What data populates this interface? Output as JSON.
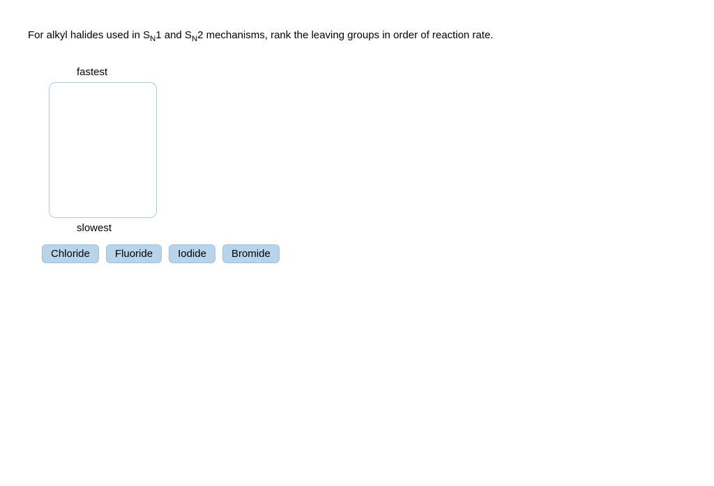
{
  "question": {
    "prefix": "For alkyl halides used in S",
    "sub1": "N",
    "mid1": "1 and S",
    "sub2": "N",
    "mid2": "2 mechanisms, rank the leaving groups in order of reaction rate."
  },
  "labels": {
    "top": "fastest",
    "bottom": "slowest"
  },
  "options": [
    "Chloride",
    "Fluoride",
    "Iodide",
    "Bromide"
  ]
}
